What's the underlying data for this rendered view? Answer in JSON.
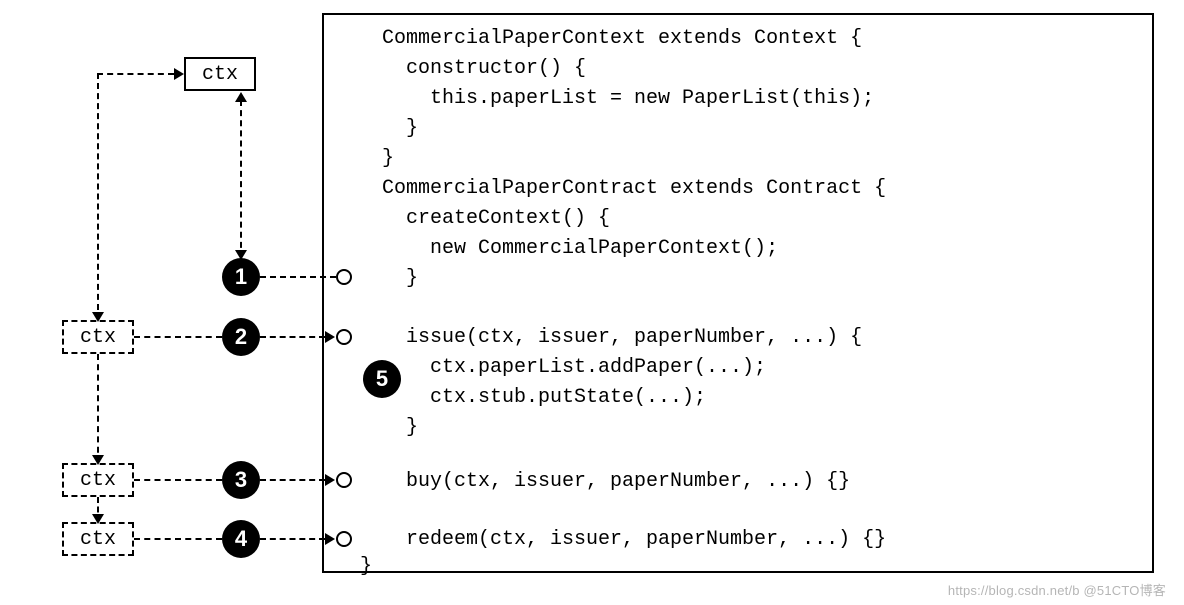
{
  "ctx": {
    "master": "ctx",
    "c2": "ctx",
    "c3": "ctx",
    "c4": "ctx"
  },
  "badges": {
    "b1": "1",
    "b2": "2",
    "b3": "3",
    "b4": "4",
    "b5": "5"
  },
  "code": {
    "l1": "CommercialPaperContext extends Context {",
    "l2": "  constructor() {",
    "l3": "    this.paperList = new PaperList(this);",
    "l4": "  }",
    "l5": "}",
    "l6": "CommercialPaperContract extends Contract {",
    "l7": "  createContext() {",
    "l8": "    new CommercialPaperContext();",
    "l9": "  }",
    "l10": "",
    "l11": "  issue(ctx, issuer, paperNumber, ...) {",
    "l12": "    ctx.paperList.addPaper(...);",
    "l13": "    ctx.stub.putState(...);",
    "l14": "  }",
    "l15": "",
    "l16": "  buy(ctx, issuer, paperNumber, ...) {}",
    "l17": "",
    "l18": "  redeem(ctx, issuer, paperNumber, ...) {}",
    "l19": "}"
  },
  "watermark": "https://blog.csdn.net/b @51CTO博客"
}
